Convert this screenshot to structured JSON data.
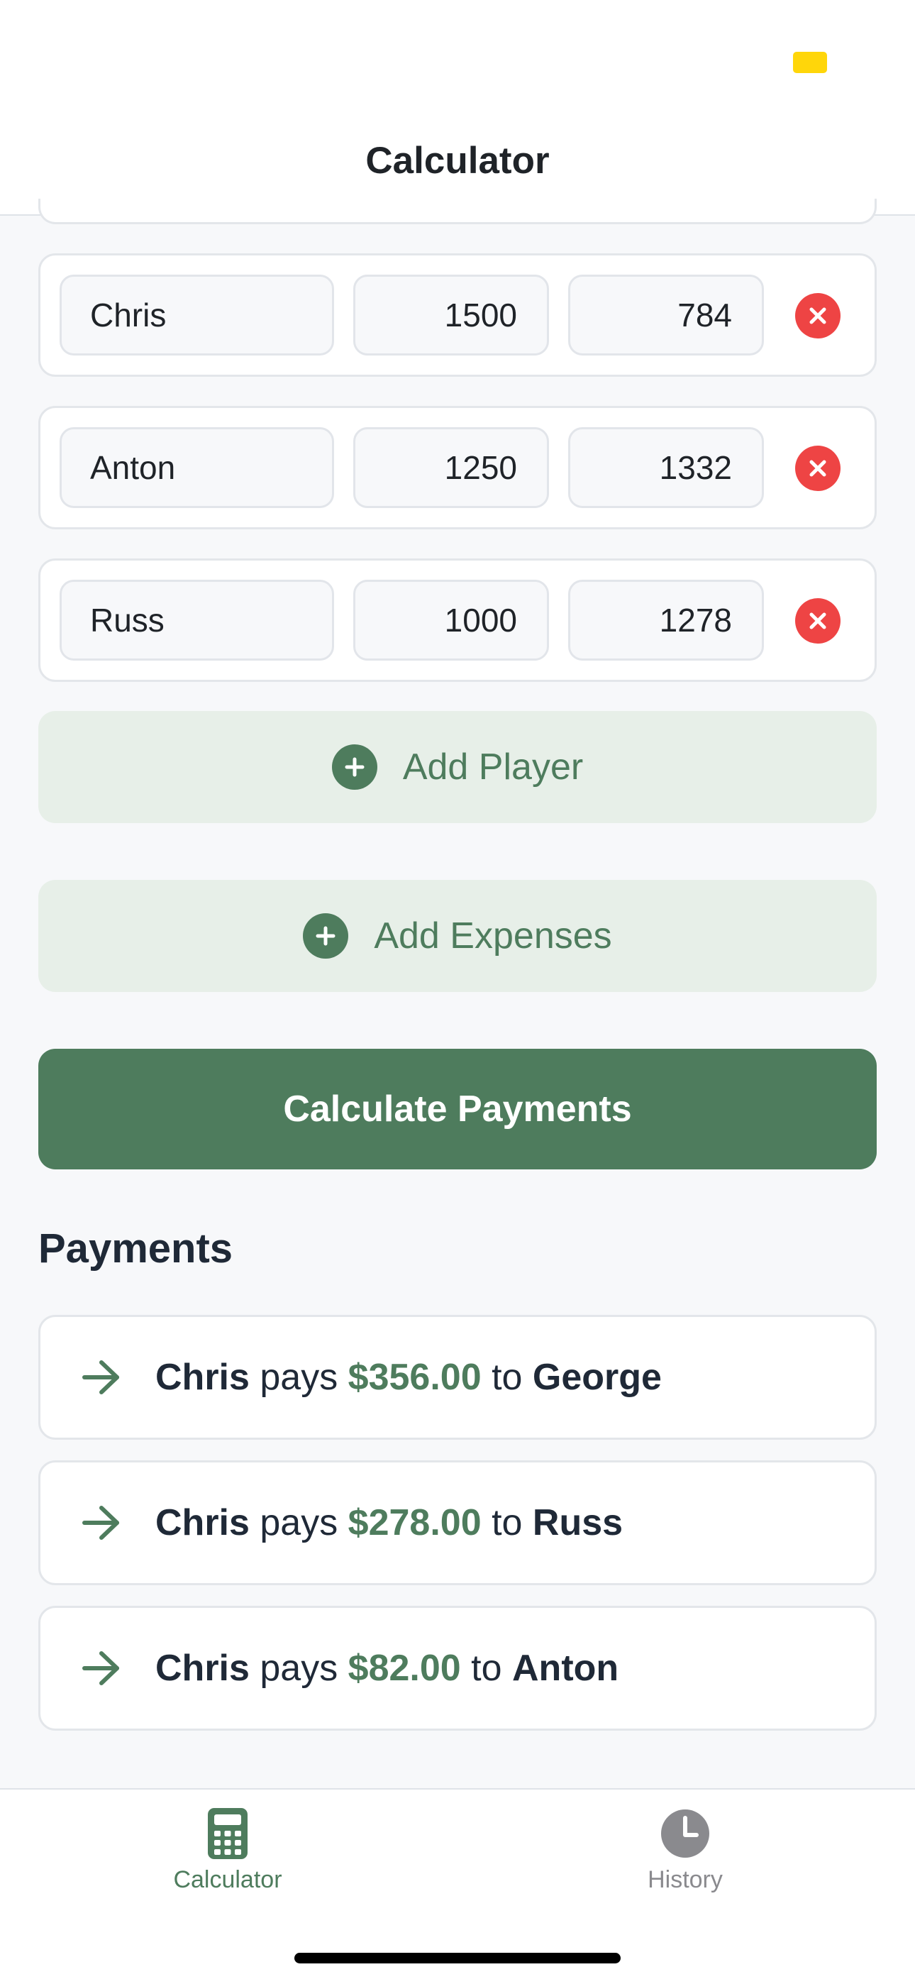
{
  "header": {
    "title": "Calculator"
  },
  "players": [
    {
      "name": "Chris",
      "value1": "1500",
      "value2": "784"
    },
    {
      "name": "Anton",
      "value1": "1250",
      "value2": "1332"
    },
    {
      "name": "Russ",
      "value1": "1000",
      "value2": "1278"
    }
  ],
  "actions": {
    "add_player": "Add Player",
    "add_expenses": "Add Expenses",
    "calculate": "Calculate Payments"
  },
  "payments": {
    "title": "Payments",
    "items": [
      {
        "from": "Chris",
        "verb": "pays",
        "amount": "$356.00",
        "prep": "to",
        "to": "George"
      },
      {
        "from": "Chris",
        "verb": "pays",
        "amount": "$278.00",
        "prep": "to",
        "to": "Russ"
      },
      {
        "from": "Chris",
        "verb": "pays",
        "amount": "$82.00",
        "prep": "to",
        "to": "Anton"
      }
    ]
  },
  "tabs": [
    {
      "label": "Calculator",
      "icon": "calculator-icon",
      "active": true
    },
    {
      "label": "History",
      "icon": "clock-icon",
      "active": false
    }
  ],
  "colors": {
    "accent": "#4e7c5d",
    "accent_light": "#e7efe8",
    "danger": "#ee4444",
    "inactive": "#8a8a8e",
    "status_indicator": "#ffd60a"
  }
}
